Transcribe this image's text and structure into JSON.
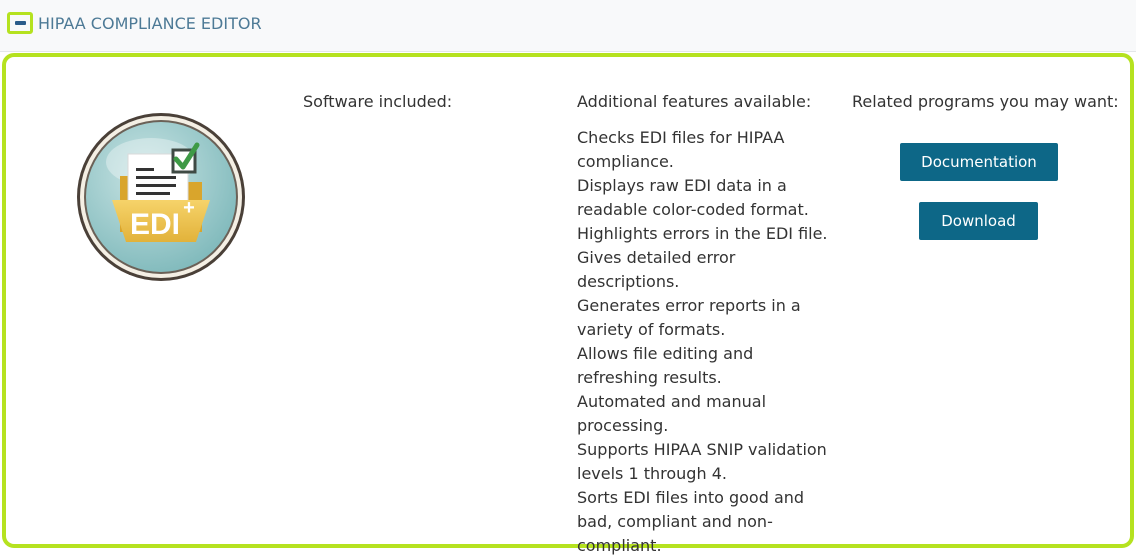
{
  "header": {
    "title": "HIPAA COMPLIANCE EDITOR",
    "toggle_icon": "minus-icon"
  },
  "panel": {
    "logo": {
      "icon": "edi-plus-logo",
      "text": "EDI",
      "superscript": "+"
    },
    "software": {
      "heading": "Software included:"
    },
    "features": {
      "heading": "Additional features available:",
      "items": [
        "Checks EDI files for HIPAA compliance.",
        "Displays raw EDI data in a readable color-coded format.",
        "Highlights errors in the EDI file.",
        "Gives detailed error descriptions.",
        "Generates error reports in a variety of formats.",
        "Allows file editing and refreshing results.",
        "Automated and manual processing.",
        "Supports HIPAA SNIP validation levels 1 through 4.",
        "Sorts EDI files into good and bad, compliant and non-compliant."
      ]
    },
    "related": {
      "heading": "Related programs you may want:",
      "documentation_label": "Documentation",
      "download_label": "Download"
    }
  },
  "colors": {
    "accent_border": "#b5e21f",
    "button": "#0d6787",
    "header_text": "#4d7a96"
  }
}
